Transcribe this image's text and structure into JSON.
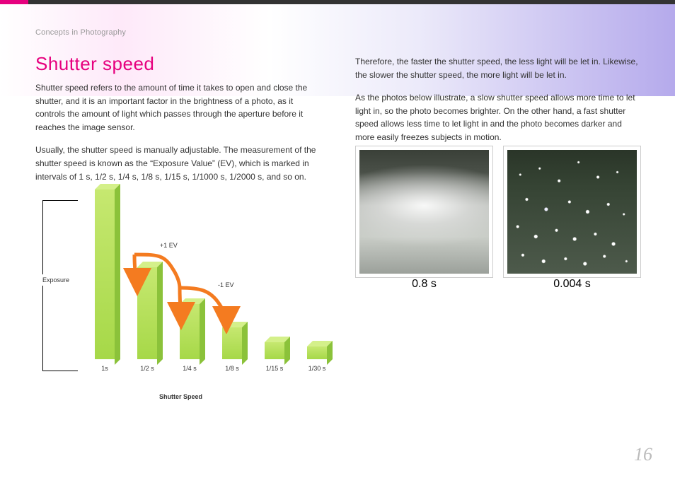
{
  "chapter": "Concepts in Photography",
  "headline": "Shutter speed",
  "left_paragraphs": [
    "Shutter speed refers to the amount of time it takes to open and close the shutter, and it is an important factor in the brightness of a photo, as it controls the amount of light which passes through the aperture before it reaches the image sensor.",
    "Usually, the shutter speed is manually adjustable. The measurement of the shutter speed is known as the “Exposure Value” (EV), which is marked in intervals of 1 s, 1/2 s, 1/4 s, 1/8 s, 1/15 s, 1/1000 s, 1/2000 s, and so on."
  ],
  "right_paragraphs": [
    "Therefore, the faster the shutter speed, the less light will be let in. Likewise, the slower the shutter speed, the more light will be let in.",
    "As the photos below illustrate, a slow shutter speed allows more time to let light in, so the photo becomes brighter. On the other hand, a fast shutter speed allows less time to let light in and the photo becomes darker and more easily freezes subjects in motion."
  ],
  "chart_data": {
    "type": "bar",
    "categories": [
      "1s",
      "1/2 s",
      "1/4 s",
      "1/8 s",
      "1/15 s",
      "1/30 s"
    ],
    "values": [
      240,
      130,
      78,
      45,
      24,
      18
    ],
    "ylabel": "Exposure",
    "xlabel": "Shutter Speed",
    "annotations": {
      "plus": "+1 EV",
      "minus": "-1 EV"
    }
  },
  "photos": [
    {
      "class": "slow",
      "caption": "0.8 s"
    },
    {
      "class": "fast",
      "caption": "0.004 s"
    }
  ],
  "page_number": "16"
}
